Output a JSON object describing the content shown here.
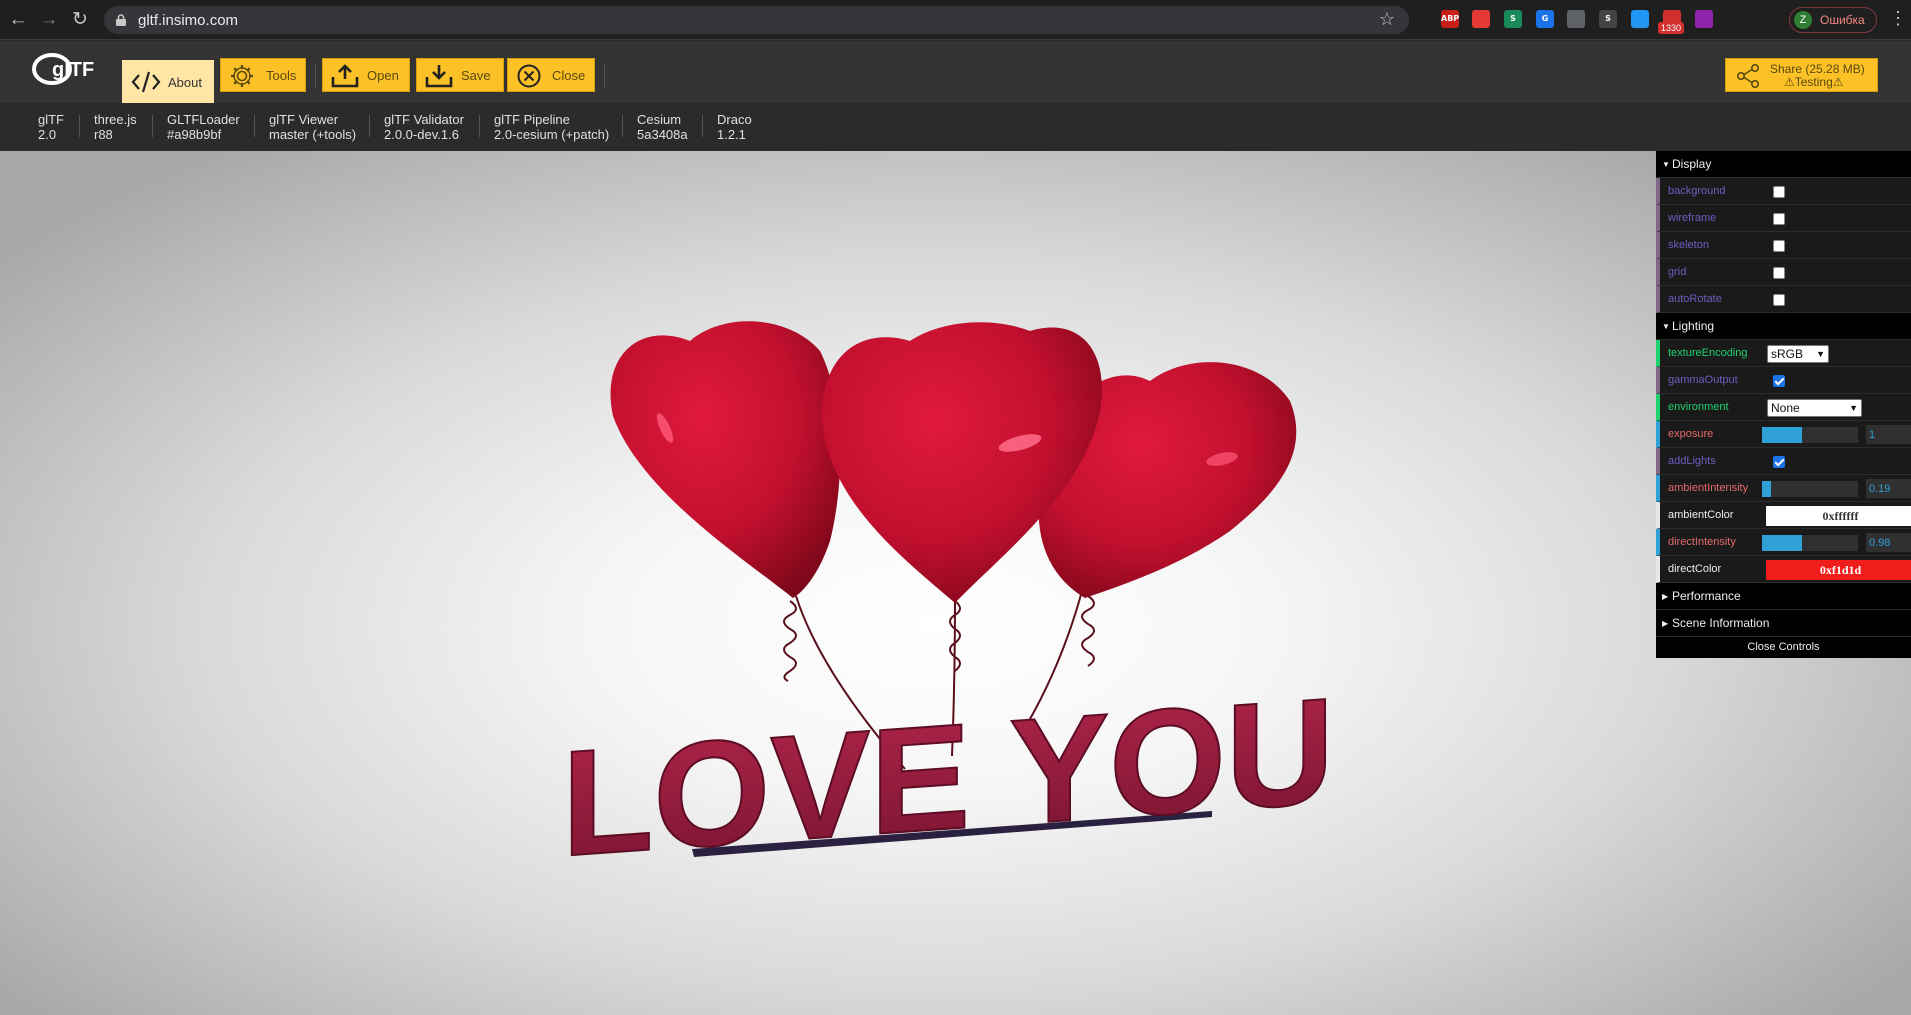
{
  "browser": {
    "url": "gltf.insimo.com",
    "extension_badge": "1330",
    "profile_initial": "Z",
    "profile_label": "Ошибка",
    "extensions": [
      {
        "name": "adblock-plus-icon",
        "label": "ABP",
        "color": "#c7201b"
      },
      {
        "name": "red-extension-icon",
        "label": "",
        "color": "#e53935"
      },
      {
        "name": "s-green-extension-icon",
        "label": "S",
        "color": "#1b8a5a"
      },
      {
        "name": "translate-icon",
        "label": "G",
        "color": "#1a73e8"
      },
      {
        "name": "shield-extension-icon",
        "label": "",
        "color": "#5f6368"
      },
      {
        "name": "s-extension-icon",
        "label": "S",
        "color": "#444"
      },
      {
        "name": "vpn-extension-icon",
        "label": "",
        "color": "#2196f3"
      },
      {
        "name": "mail-extension-icon",
        "label": "",
        "color": "#d32f2f"
      },
      {
        "name": "colorful-extension-icon",
        "label": "",
        "color": "#8e24aa"
      },
      {
        "name": "puzzle-icon",
        "label": "",
        "color": "#1f1f1f"
      },
      {
        "name": "reading-list-icon",
        "label": "",
        "color": "#1f1f1f"
      }
    ]
  },
  "toolbar": {
    "logo_text": "glTF",
    "about": "About",
    "tools": "Tools",
    "open": "Open",
    "save": "Save",
    "close": "Close",
    "share_line1": "Share (25.28 MB)",
    "share_line2": "⚠Testing⚠"
  },
  "versions": [
    {
      "name": "glTF",
      "version": "2.0"
    },
    {
      "name": "three.js",
      "version": "r88"
    },
    {
      "name": "GLTFLoader",
      "version": "#a98b9bf"
    },
    {
      "name": "glTF Viewer",
      "version": "master (+tools)"
    },
    {
      "name": "glTF Validator",
      "version": "2.0.0-dev.1.6"
    },
    {
      "name": "glTF Pipeline",
      "version": "2.0-cesium (+patch)"
    },
    {
      "name": "Cesium",
      "version": "5a3408a"
    },
    {
      "name": "Draco",
      "version": "1.2.1"
    }
  ],
  "scene": {
    "text": "LOVE YOU",
    "balloon_color": "#c8102e",
    "text_color": "#9b1b3c"
  },
  "gui": {
    "display": {
      "title": "Display",
      "background": {
        "label": "background",
        "value": false
      },
      "wireframe": {
        "label": "wireframe",
        "value": false
      },
      "skeleton": {
        "label": "skeleton",
        "value": false
      },
      "grid": {
        "label": "grid",
        "value": false
      },
      "autoRotate": {
        "label": "autoRotate",
        "value": false
      }
    },
    "lighting": {
      "title": "Lighting",
      "textureEncoding": {
        "label": "textureEncoding",
        "value": "sRGB"
      },
      "gammaOutput": {
        "label": "gammaOutput",
        "value": true
      },
      "environment": {
        "label": "environment",
        "value": "None"
      },
      "exposure": {
        "label": "exposure",
        "value": "1",
        "fraction": 0.42
      },
      "addLights": {
        "label": "addLights",
        "value": true
      },
      "ambientIntensity": {
        "label": "ambientIntensity",
        "value": "0.19",
        "fraction": 0.09
      },
      "ambientColor": {
        "label": "ambientColor",
        "value": "0xffffff",
        "color": "#ffffff",
        "text_color": "#333333"
      },
      "directIntensity": {
        "label": "directIntensity",
        "value": "0.98",
        "fraction": 0.42
      },
      "directColor": {
        "label": "directColor",
        "value": "0xf1d1d",
        "color": "#f11d1d",
        "text_color": "#ffffff"
      }
    },
    "performance": "Performance",
    "scene_information": "Scene Information",
    "close_controls": "Close Controls"
  }
}
